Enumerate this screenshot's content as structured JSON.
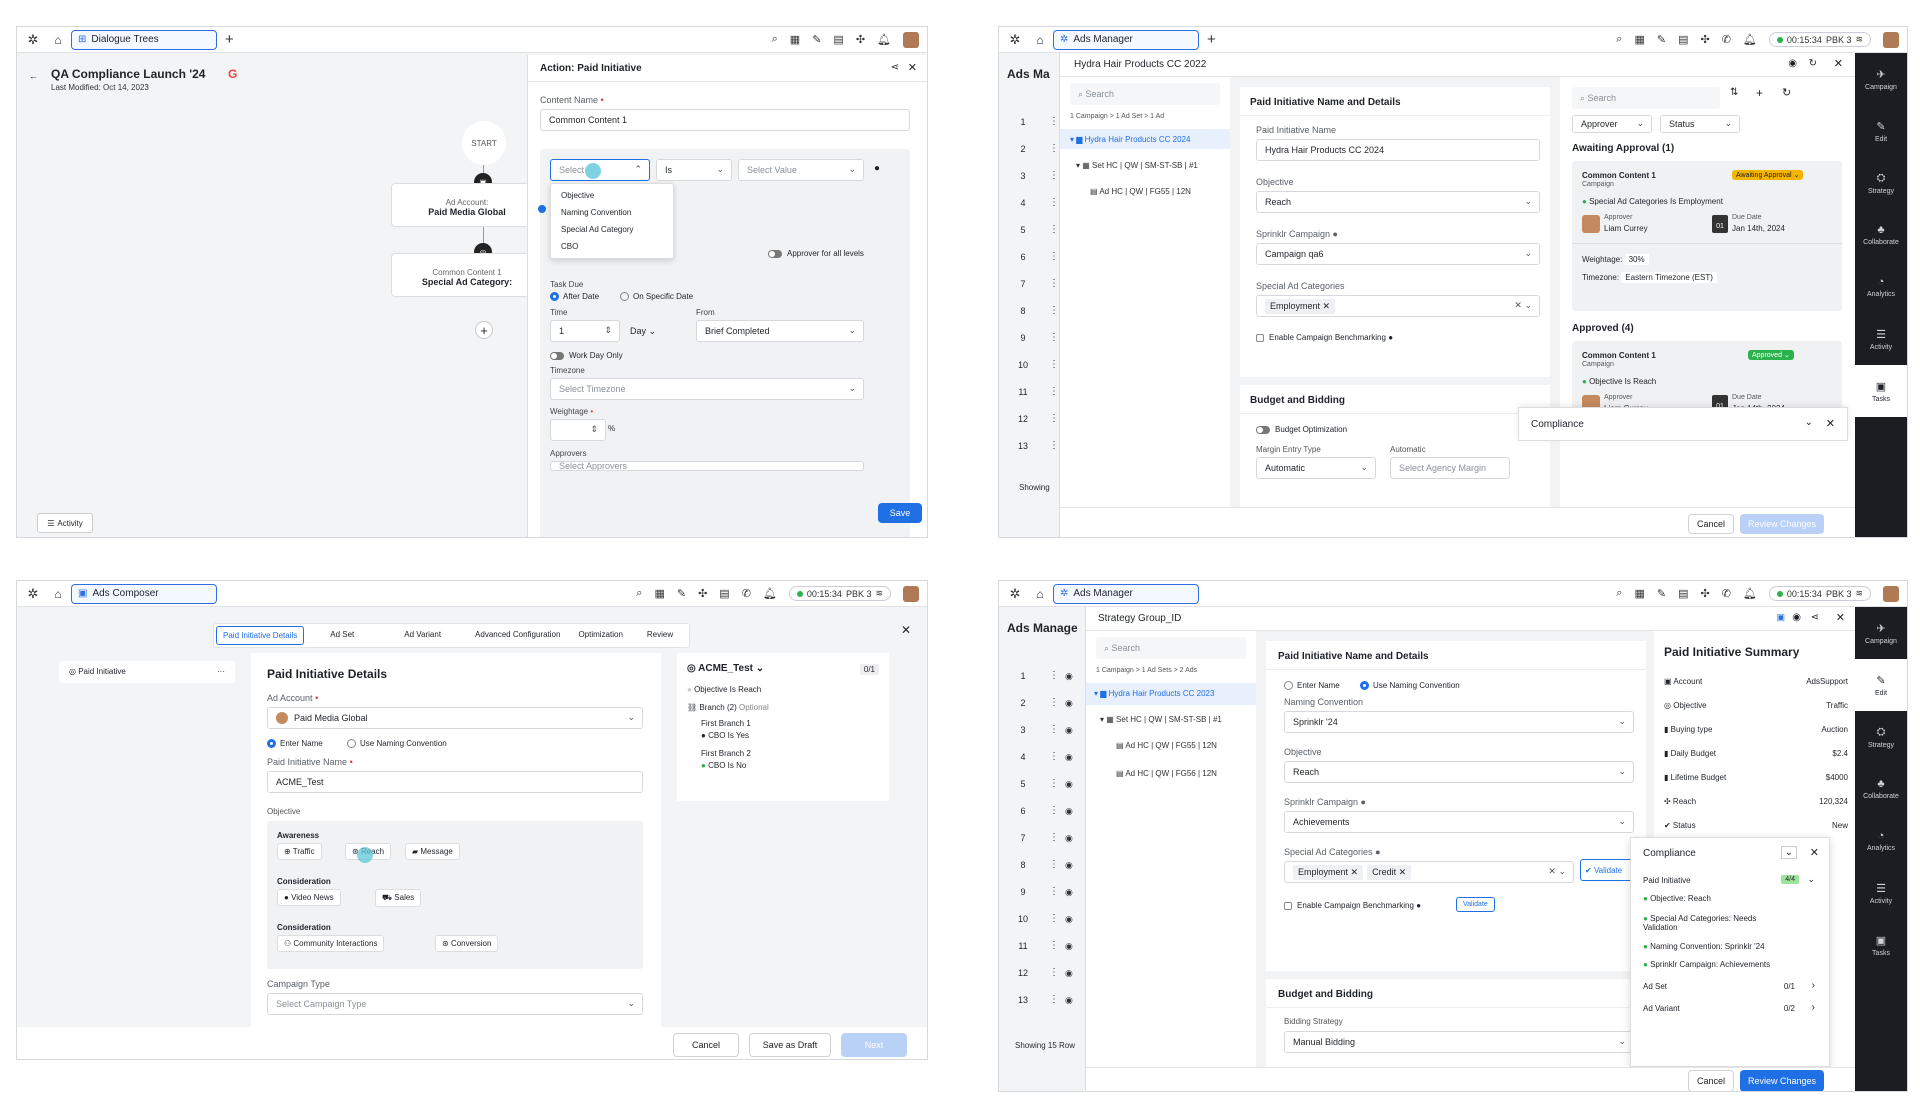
{
  "p1": {
    "app_tab": "Dialogue Trees",
    "title": "QA Compliance Launch '24",
    "last_modified": "Last Modified: Oct 14, 2023",
    "start": "START",
    "node1_sub": "Ad Account:",
    "node1_main": "Paid Media Global",
    "node2_sub": "Common Content 1",
    "node2_main": "Special Ad Category:",
    "activity": "Activity",
    "drawer_title": "Action: Paid Initiative",
    "content_name_label": "Content Name",
    "content_name_value": "Common Content 1",
    "select_ph": "Select",
    "is_value": "Is",
    "select_value_ph": "Select Value",
    "dropdown": [
      "Objective",
      "Naming Convention",
      "Special Ad Category",
      "CBO"
    ],
    "approver_all": "Approver for all levels",
    "task_due": "Task Due",
    "after_date": "After Date",
    "on_specific": "On Specific Date",
    "time_label": "Time",
    "time_value": "1",
    "day_value": "Day",
    "from_label": "From",
    "from_value": "Brief Completed",
    "workday": "Work Day Only",
    "timezone_label": "Timezone",
    "timezone_ph": "Select Timezone",
    "weightage_label": "Weightage",
    "pct": "%",
    "approvers_label": "Approvers",
    "approvers_ph": "Select Approvers",
    "save": "Save"
  },
  "topbar": {
    "timer": "00:15:34",
    "pbk": "PBK 3"
  },
  "p2": {
    "app_tab": "Ads Manager",
    "ads_ma": "Ads Ma",
    "drawer_title": "Hydra Hair Products CC 2022",
    "search": "Search",
    "breadcrumb": "1 Campaign > 1 Ad Set > 1 Ad",
    "tree": [
      "Hydra Hair Products CC 2024",
      "Set HC | QW | SM-ST-SB | #1",
      "Ad HC | QW | FG55 | 12N"
    ],
    "rows": [
      "1",
      "2",
      "3",
      "4",
      "5",
      "6",
      "7",
      "8",
      "9",
      "10",
      "11",
      "12",
      "13"
    ],
    "showing": "Showing",
    "section_title": "Paid Initiative Name and Details",
    "pi_name_label": "Paid Initiative Name",
    "pi_name_value": "Hydra Hair Products CC 2024",
    "objective_label": "Objective",
    "objective_value": "Reach",
    "sprinklr_label": "Sprinklr Campaign",
    "sprinklr_value": "Campaign qa6",
    "sac_label": "Special Ad Categories",
    "sac_chip": "Employment",
    "benchmark": "Enable Campaign Benchmarking",
    "budget_title": "Budget and Bidding",
    "budget_opt": "Budget Optimization",
    "margin_label": "Margin Entry Type",
    "margin_value": "Automatic",
    "automatic_label": "Automatic",
    "agency_ph": "Select Agency Margin",
    "compliance": "Compliance",
    "cancel": "Cancel",
    "review": "Review Changes",
    "r_search": "Search",
    "approver_filter": "Approver",
    "status_filter": "Status",
    "awaiting_title": "Awaiting Approval (1)",
    "c1_title": "Common Content 1",
    "c1_sub": "Campaign",
    "c1_badge": "Awaiting Approval",
    "c1_check": "Special Ad Categories Is Employment",
    "approver_lbl": "Approver",
    "approver_name": "Liam Currey",
    "due_lbl": "Due Date",
    "due_val": "Jan 14th, 2024",
    "cal_day": "01",
    "weightage_lbl": "Weightage:",
    "weightage_val": "30%",
    "timezone_lbl": "Timezone:",
    "timezone_val": "Eastern Timezone (EST)",
    "approved_title": "Approved (4)",
    "c2_title": "Common Content 1",
    "c2_sub": "Campaign",
    "c2_badge": "Approved",
    "c2_check": "Objective Is Reach",
    "side": [
      "Campaign",
      "Edit",
      "Strategy",
      "Collaborate",
      "Analytics",
      "Activity",
      "Tasks"
    ]
  },
  "p3": {
    "app_tab": "Ads Composer",
    "tabs": [
      "Paid Initiative Details",
      "Ad Set",
      "Ad Variant",
      "Advanced Configuration",
      "Optimization",
      "Review"
    ],
    "left_item": "Paid Initiative",
    "heading": "Paid Initiative Details",
    "ad_account_label": "Ad Account",
    "ad_account_value": "Paid Media Global",
    "enter_name": "Enter Name",
    "use_naming": "Use Naming Convention",
    "pi_name_label": "Paid Initiative Name",
    "pi_name_value": "ACME_Test",
    "objective_label": "Objective",
    "awareness": "Awareness",
    "traffic": "Traffic",
    "reach": "Reach",
    "message": "Message",
    "consideration1": "Consideration",
    "video_news": "Video News",
    "sales": "Sales",
    "consideration2": "Consideration",
    "community": "Community Interactions",
    "conversion": "Conversion",
    "campaign_type_label": "Campaign Type",
    "campaign_type_ph": "Select Campaign Type",
    "rule_title": "ACME_Test",
    "rule_count": "0/1",
    "rule_obj": "Objective Is Reach",
    "branch": "Branch (2)",
    "optional": "Optional",
    "fb1": "First Branch 1",
    "fb1_rule": "CBO Is Yes",
    "fb2": "First Branch 2",
    "fb2_rule": "CBO Is No",
    "cancel": "Cancel",
    "draft": "Save as Draft",
    "next": "Next"
  },
  "p4": {
    "app_tab": "Ads Manager",
    "ads_manage": "Ads Manage",
    "drawer_title": "Strategy Group_ID",
    "search": "Search",
    "breadcrumb": "1 Campaign > 1 Ad Sets > 2 Ads",
    "tree": [
      "Hydra Hair Products CC 2023",
      "Set HC | QW | SM-ST-SB | #1",
      "Ad HC | QW | FG55 | 12N",
      "Ad HC | QW | FG56 | 12N"
    ],
    "rows": [
      "1",
      "2",
      "3",
      "4",
      "5",
      "6",
      "7",
      "8",
      "9",
      "10",
      "11",
      "12",
      "13"
    ],
    "showing": "Showing 15 Row",
    "section_title": "Paid Initiative Name and Details",
    "enter_name": "Enter Name",
    "use_naming": "Use Naming Convention",
    "naming_label": "Naming Convention",
    "naming_value": "Sprinklr '24",
    "objective_label": "Objective",
    "objective_value": "Reach",
    "sprinklr_label": "Sprinklr Campaign",
    "sprinklr_value": "Achievements",
    "sac_label": "Special Ad Categories",
    "chip1": "Employment",
    "chip2": "Credit",
    "validate_btn": "Validate",
    "benchmark": "Enable Campaign Benchmarking",
    "validate2": "Validate",
    "budget_title": "Budget and Bidding",
    "bidding_label": "Bidding Strategy",
    "bidding_value": "Manual Bidding",
    "summary_title": "Paid Initiative Summary",
    "summary": [
      {
        "k": "Account",
        "v": "AdsSupport"
      },
      {
        "k": "Objective",
        "v": "Traffic"
      },
      {
        "k": "Buying type",
        "v": "Auction"
      },
      {
        "k": "Daily Budget",
        "v": "$2.4"
      },
      {
        "k": "Lifetime Budget",
        "v": "$4000"
      },
      {
        "k": "Reach",
        "v": "120,324"
      },
      {
        "k": "Status",
        "v": "New"
      }
    ],
    "compliance": "Compliance",
    "pi_label": "Paid Initiative",
    "pi_count": "4/4",
    "checks": [
      "Objective: Reach",
      "Special Ad Categories: Needs Validation",
      "Naming Convention: Sprinklr '24",
      "Sprinklr Campaign: Achievements"
    ],
    "adset": "Ad Set",
    "adset_count": "0/1",
    "advariant": "Ad Variant",
    "advariant_count": "0/2",
    "cancel": "Cancel",
    "review": "Review Changes",
    "side": [
      "Campaign",
      "Edit",
      "Strategy",
      "Collaborate",
      "Analytics",
      "Activity",
      "Tasks"
    ]
  },
  "colors": {
    "primary": "#1f6fe5",
    "success": "#2bb24c",
    "warning": "#f5b400",
    "dark": "#1b1d22"
  }
}
